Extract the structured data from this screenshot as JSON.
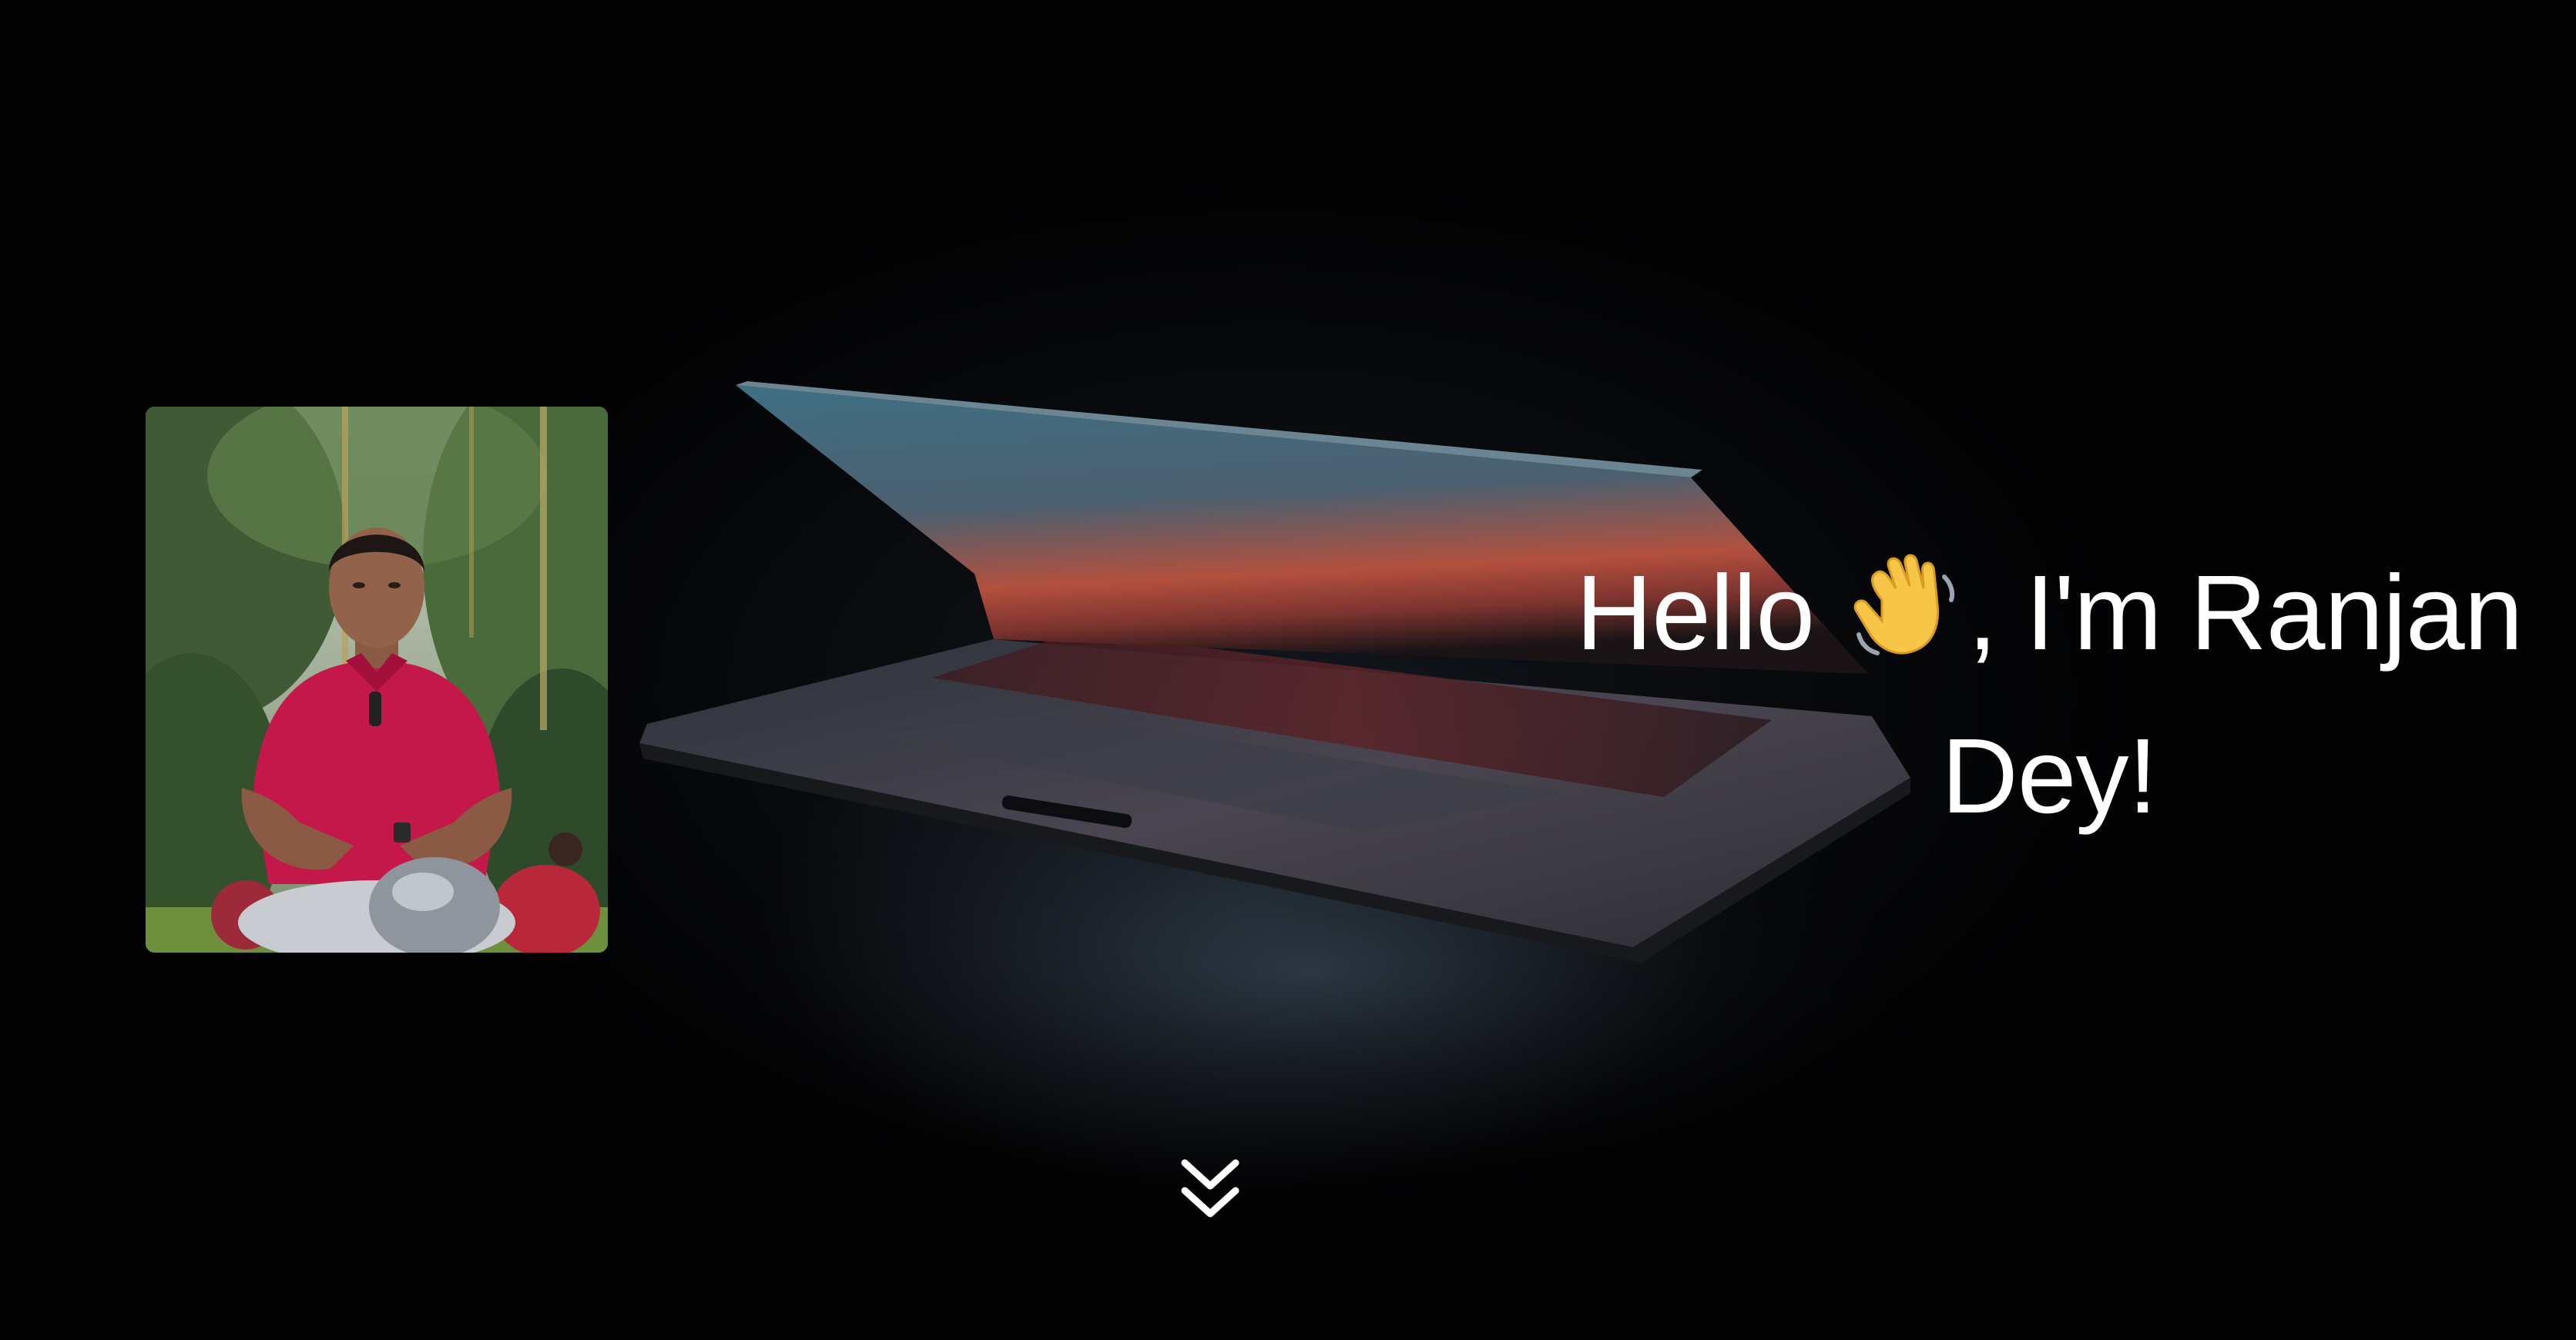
{
  "hero": {
    "greeting_prefix": "Hello",
    "greeting_suffix": ", I'm Ranjan",
    "greeting_line2": "Dey!",
    "wave_icon": "waving-hand-icon",
    "background_image": "closed-laptop-dark-photo",
    "profile_image": "profile-photo-man-red-polo",
    "scroll_icon": "double-chevron-down-icon"
  },
  "colors": {
    "background": "#000000",
    "text": "#ffffff",
    "wave_emoji": "#f7c548"
  }
}
